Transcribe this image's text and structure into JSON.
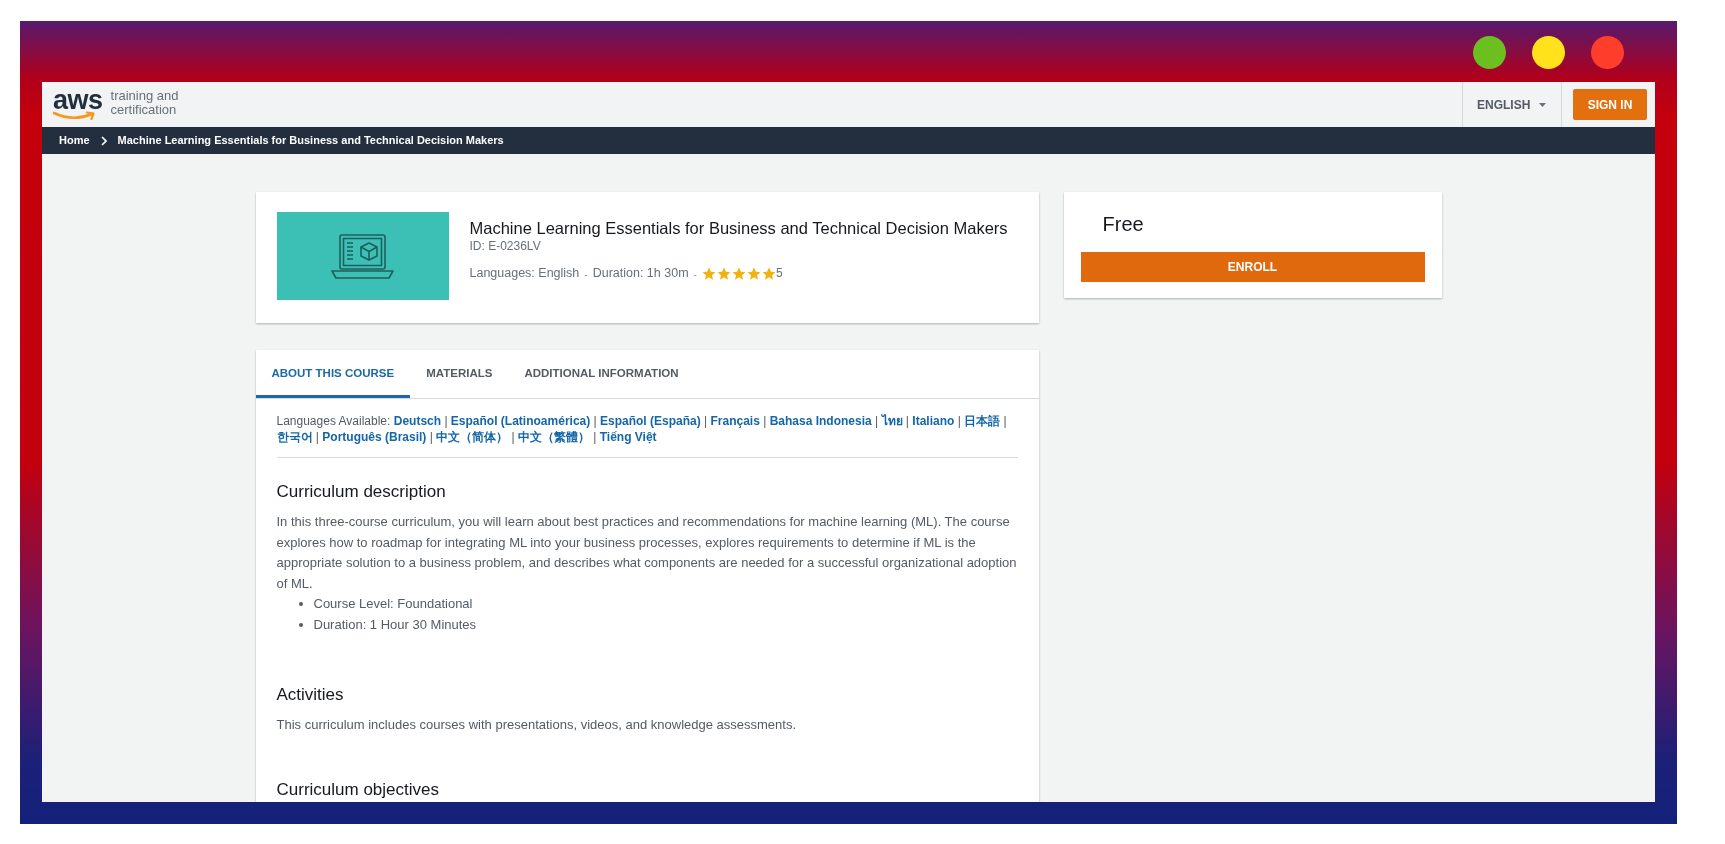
{
  "window_controls": [
    {
      "color": "#6bbf1e"
    },
    {
      "color": "#ffe21c"
    },
    {
      "color": "#ff3d2b"
    }
  ],
  "header": {
    "logo": {
      "wordmark": "aws",
      "tagline": [
        "training and",
        "certification"
      ]
    },
    "language": "ENGLISH",
    "sign_in": "SIGN IN"
  },
  "breadcrumb": [
    {
      "label": "Home"
    },
    {
      "label": "Machine Learning Essentials for Business and Technical Decision Makers"
    }
  ],
  "course": {
    "title": "Machine Learning Essentials for Business and Technical Decision Makers",
    "id": "ID: E-0236LV",
    "meta": [
      {
        "text": "Languages: English",
        "separator": "-"
      },
      {
        "text": "Duration: 1h 30m",
        "separator": "-"
      }
    ],
    "stars": 5,
    "rating": "5"
  },
  "enroll": {
    "price": "Free",
    "button": "ENROLL"
  },
  "tabs": [
    {
      "label": "ABOUT THIS COURSE",
      "selected": true
    },
    {
      "label": "MATERIALS",
      "selected": false
    },
    {
      "label": "ADDITIONAL INFORMATION",
      "selected": false
    }
  ],
  "languages_available": {
    "label": "Languages Available:",
    "links": [
      {
        "label": "Deutsch",
        "separator": "|"
      },
      {
        "label": "Español (Latinoamérica)",
        "separator": "|"
      },
      {
        "label": "Español (España)",
        "separator": "|"
      },
      {
        "label": "Français",
        "separator": "|"
      },
      {
        "label": "Bahasa Indonesia",
        "separator": "|"
      },
      {
        "label": "ไทย",
        "separator": "|"
      },
      {
        "label": "Italiano",
        "separator": "|"
      },
      {
        "label": "日本語",
        "separator": "|"
      },
      {
        "label": "한국어",
        "separator": "|"
      },
      {
        "label": "Português (Brasil)",
        "separator": "|"
      },
      {
        "label": "中文（简体）",
        "separator": "|"
      },
      {
        "label": "中文（繁體）",
        "separator": "|"
      },
      {
        "label": "Tiếng Việt"
      }
    ]
  },
  "sections": [
    {
      "heading": "Curriculum description",
      "paragraph": "In this three-course curriculum, you will learn about best practices and recommendations for machine learning (ML). The course explores how to roadmap for integrating ML into your business processes, explores requirements to determine if ML is the appropriate solution to a business problem, and describes what components are needed for a successful organizational adoption of ML.",
      "bullets": [
        "Course Level: Foundational",
        "Duration: 1 Hour 30 Minutes"
      ]
    },
    {
      "heading": "Activities",
      "paragraph": "This curriculum includes courses with presentations, videos, and knowledge assessments."
    },
    {
      "heading": "Curriculum objectives"
    }
  ]
}
